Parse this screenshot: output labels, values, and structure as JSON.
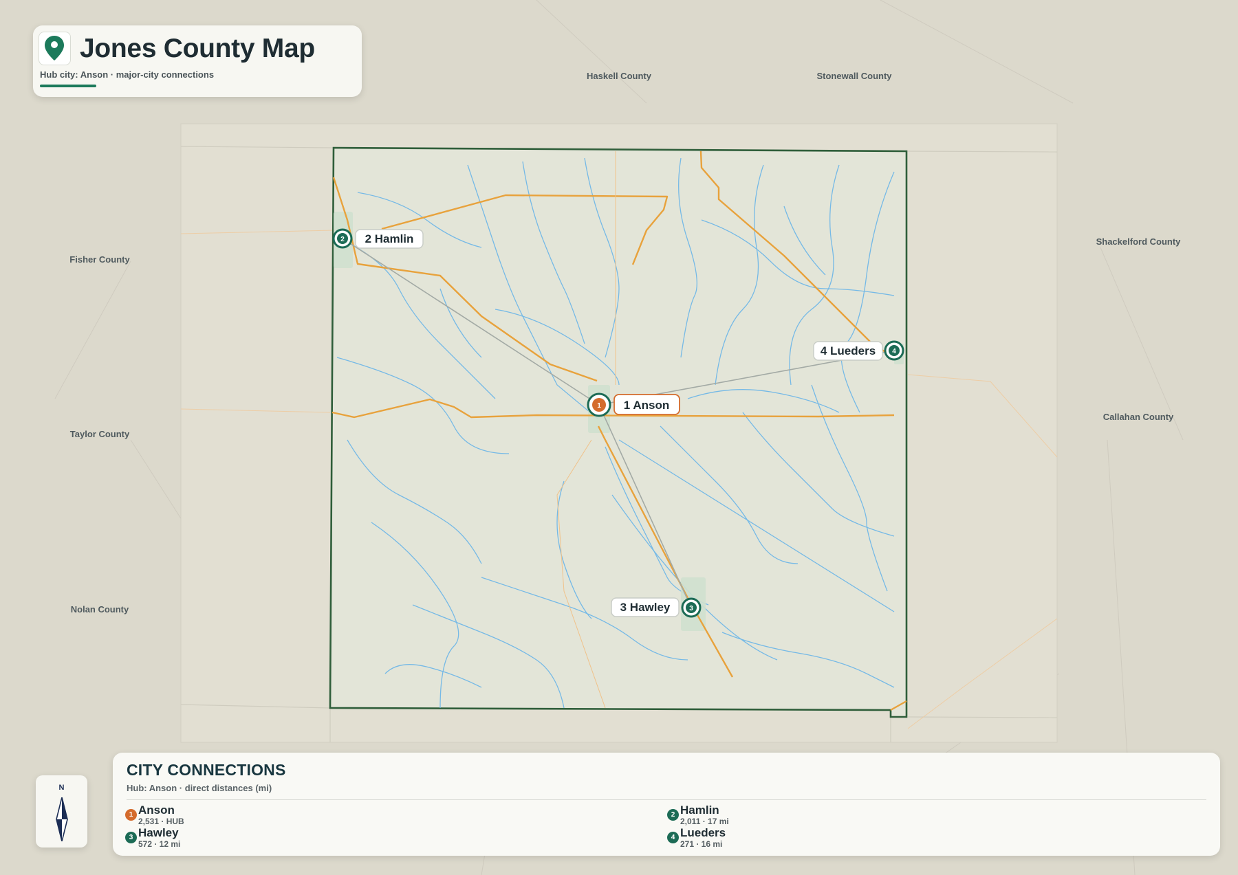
{
  "title": {
    "heading": "Jones County Map",
    "subtitle": "Hub city: Anson · major-city connections"
  },
  "icons": {
    "title": "map-pin-icon",
    "compass": "north-arrow-icon"
  },
  "colors": {
    "county_border": "#2f5e3a",
    "hub": "#d46b2c",
    "city": "#1c6b55",
    "roads": "#e8a23c",
    "rivers": "#6ab5e8",
    "connection_lines": "#a3aaa5"
  },
  "neighbor_counties": [
    {
      "id": "haskell",
      "name": "Haskell County"
    },
    {
      "id": "stonewall",
      "name": "Stonewall County"
    },
    {
      "id": "fisher",
      "name": "Fisher County"
    },
    {
      "id": "shackelford",
      "name": "Shackelford County"
    },
    {
      "id": "taylor",
      "name": "Taylor County"
    },
    {
      "id": "callahan",
      "name": "Callahan County"
    },
    {
      "id": "nolan",
      "name": "Nolan County"
    }
  ],
  "map_labels": {
    "anson": "1 Anson",
    "hamlin": "2 Hamlin",
    "hawley": "3 Hawley",
    "lueders": "4 Lueders"
  },
  "connections": {
    "title": "CITY CONNECTIONS",
    "subtitle": "Hub: Anson · direct distances (mi)",
    "cities": [
      {
        "id": "anson",
        "rank": "1",
        "name": "Anson",
        "stat": "2,531 · HUB",
        "hub": true
      },
      {
        "id": "hamlin",
        "rank": "2",
        "name": "Hamlin",
        "stat": "2,011 · 17 mi",
        "hub": false
      },
      {
        "id": "hawley",
        "rank": "3",
        "name": "Hawley",
        "stat": "572 · 12 mi",
        "hub": false
      },
      {
        "id": "lueders",
        "rank": "4",
        "name": "Lueders",
        "stat": "271 · 16 mi",
        "hub": false
      }
    ]
  },
  "compass": {
    "label": "N"
  }
}
